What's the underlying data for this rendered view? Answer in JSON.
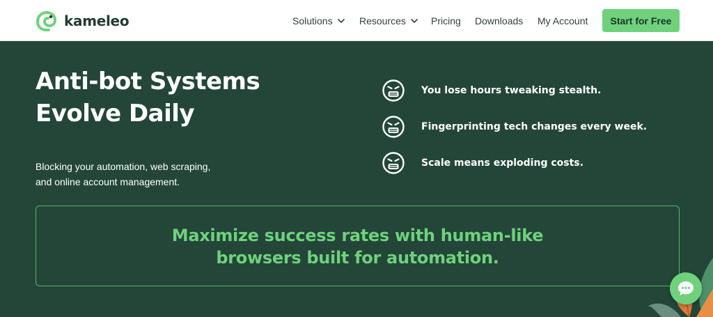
{
  "header": {
    "logo_text": "kameleo",
    "nav": [
      {
        "label": "Solutions",
        "has_dropdown": true
      },
      {
        "label": "Resources",
        "has_dropdown": true
      },
      {
        "label": "Pricing",
        "has_dropdown": false
      },
      {
        "label": "Downloads",
        "has_dropdown": false
      },
      {
        "label": "My Account",
        "has_dropdown": false
      }
    ],
    "cta_label": "Start for Free"
  },
  "hero": {
    "title_line1": "Anti-bot Systems",
    "title_line2": "Evolve Daily",
    "subtitle_line1": "Blocking your automation, web scraping,",
    "subtitle_line2": "and online account management."
  },
  "pain_points": [
    {
      "icon": "angry-face-icon",
      "text": "You lose hours tweaking stealth."
    },
    {
      "icon": "angry-face-icon",
      "text": "Fingerprinting tech changes every week."
    },
    {
      "icon": "angry-face-icon",
      "text": "Scale means exploding costs."
    }
  ],
  "banner": {
    "line1": "Maximize success rates with human-like",
    "line2": "browsers built for automation."
  },
  "chat": {
    "icon": "chat-bubble-icon"
  },
  "colors": {
    "background": "#234639",
    "accent": "#6fd17c",
    "header_bg": "#ffffff",
    "text_dark": "#2e4139"
  }
}
